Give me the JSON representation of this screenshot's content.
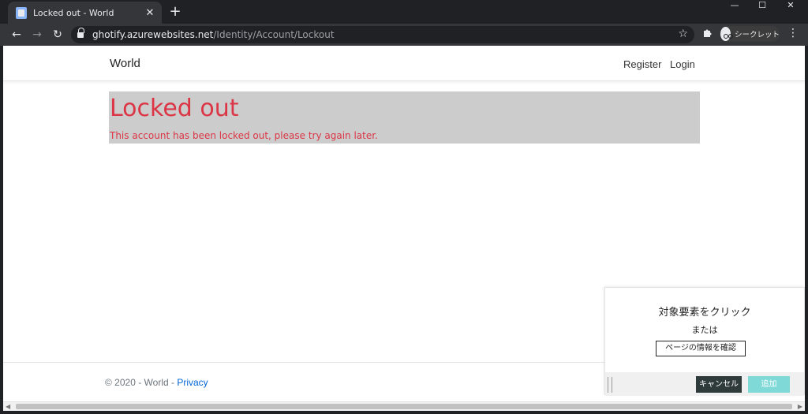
{
  "browser": {
    "tab_title": "Locked out - World",
    "tab_close": "✕",
    "new_tab": "+",
    "window_controls": {
      "minimize": "—",
      "maximize": "☐",
      "close": "✕"
    },
    "nav": {
      "back": "←",
      "forward": "→",
      "reload": "↻"
    },
    "url_domain": "ghotify.azurewebsites.net",
    "url_path": "/Identity/Account/Lockout",
    "bookmark_star": "☆",
    "extensions_icon": "puzzle-icon",
    "incognito_label": "シークレット",
    "menu": "⋮"
  },
  "site": {
    "brand": "World",
    "nav_register": "Register",
    "nav_login": "Login"
  },
  "lockout": {
    "heading": "Locked out",
    "message": "This account has been locked out, please try again later."
  },
  "footer": {
    "copyright": "© 2020 - World - ",
    "privacy_link": "Privacy"
  },
  "picker": {
    "instruction": "対象要素をクリック",
    "or": "または",
    "page_info_button": "ページの情報を確認",
    "cancel_button": "キャンセル",
    "add_button": "追加",
    "colors": {
      "cancel_bg": "#2f3a3a",
      "add_bg": "#7fd9d6"
    }
  },
  "scrollbar": {
    "left_arrow": "◀",
    "right_arrow": "▶"
  },
  "colors": {
    "danger": "#dc3545",
    "lockbox_bg": "#cccccc",
    "link": "#0366d6"
  }
}
